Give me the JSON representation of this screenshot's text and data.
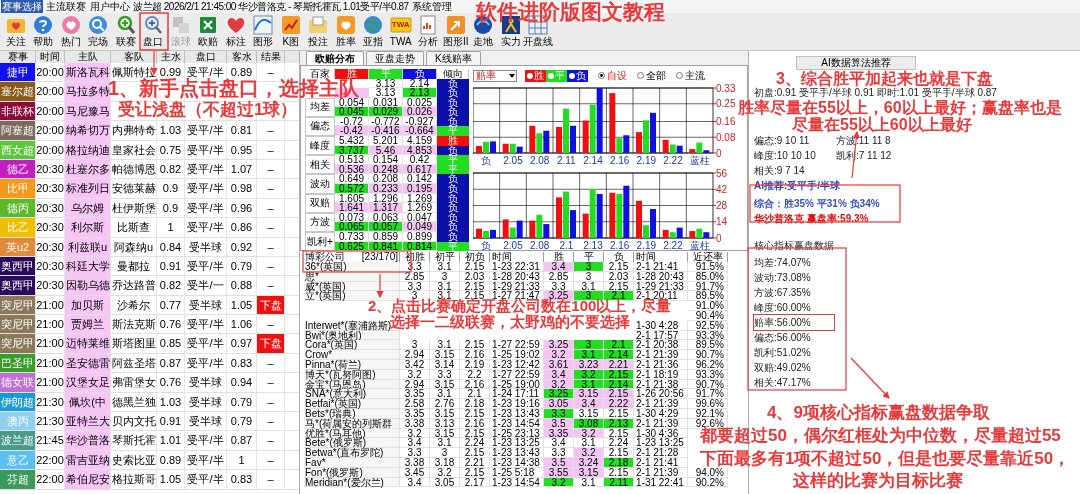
{
  "menu": {
    "items": [
      {
        "label": "赛事选择",
        "selected": true
      },
      {
        "label": "主流联赛",
        "selected": false
      },
      {
        "label": "用户中心",
        "selected": false
      }
    ],
    "match_info": "波兰超 2026/2/1 21:45:00 华沙普洛克 - 琴斯托霍瓦 1.01受平/半0.87",
    "trailing": [
      {
        "label": "系统管理",
        "selected": false
      }
    ]
  },
  "tutorial_title": "软件进阶版图文教程",
  "toolbar": [
    {
      "label": "关注",
      "disabled": false
    },
    {
      "label": "帮助",
      "disabled": false
    },
    {
      "label": "热门",
      "disabled": false
    },
    {
      "label": "完场",
      "disabled": false
    },
    {
      "label": "联赛",
      "disabled": false
    },
    {
      "label": "盘口",
      "disabled": false
    },
    {
      "label": "滚球",
      "disabled": true
    },
    {
      "label": "欧赔",
      "disabled": false
    },
    {
      "label": "标注",
      "disabled": false
    },
    {
      "label": "图形",
      "disabled": false
    },
    {
      "label": "K图",
      "disabled": false
    },
    {
      "label": "投注",
      "disabled": false
    },
    {
      "label": "胜率",
      "disabled": false
    },
    {
      "label": "亚指",
      "disabled": false
    },
    {
      "label": "TWA",
      "icon_text": "TWA",
      "disabled": false
    },
    {
      "label": "分析",
      "disabled": false
    },
    {
      "label": "图形II",
      "disabled": false
    },
    {
      "label": "走地",
      "disabled": false
    },
    {
      "label": "实力",
      "disabled": false
    },
    {
      "label": "开盘线",
      "disabled": false
    }
  ],
  "matches": {
    "columns": [
      "赛事",
      "时间",
      "主队",
      "客队",
      "主水",
      "盘口",
      "客水",
      "结果"
    ],
    "rows": [
      {
        "league": "捷甲",
        "color": "#1010f0",
        "time": "20:00",
        "home": "斯洛瓦科",
        "away": "佩斯特拉",
        "home_odds": "0.99",
        "handicap": "受平/半",
        "away_odds": "0.89",
        "result": "–",
        "flagged": false
      },
      {
        "league": "塞尔超",
        "color": "#8a5a1a",
        "time": "20:00",
        "home": "马拉多特"
      },
      {
        "league": "非联杯",
        "color": "#8a0a3a",
        "time": "20:00",
        "home": "马尼豫马"
      },
      {
        "league": "阿塞超",
        "color": "#7a6a5a",
        "time": "20:00",
        "home": "纳希切万",
        "away": "内弗特奇",
        "home_odds": "1.03",
        "handicap": "受平/半",
        "away_odds": "0.81",
        "result": "–",
        "flagged": false
      },
      {
        "league": "西女超",
        "color": "#5ac83a",
        "time": "20:00",
        "home": "格拉纳迪",
        "away": "皇家社会",
        "home_odds": "0.75",
        "handicap": "受平/半",
        "away_odds": "0.95",
        "result": "–",
        "flagged": false
      },
      {
        "league": "德乙",
        "color": "#c020c0",
        "time": "20:30",
        "home": "杜塞尔多",
        "away": "帕德博恩",
        "home_odds": "0.82",
        "handicap": "受平/半",
        "away_odds": "1.07",
        "result": "–",
        "flagged": false
      },
      {
        "league": "比甲",
        "color": "#f39a1a",
        "time": "20:30",
        "home": "标准列日",
        "away": "安德莱赫",
        "home_odds": "0.9",
        "handicap": "受平/半",
        "away_odds": "0.98",
        "result": "–",
        "flagged": false
      },
      {
        "league": "德丙",
        "color": "#5aba2a",
        "time": "20:30",
        "home": "乌尔姆",
        "away": "杜伊斯堡",
        "home_odds": "0.9",
        "handicap": "受平/半",
        "away_odds": "0.96",
        "result": "–",
        "flagged": false
      },
      {
        "league": "比乙",
        "color": "#f0c000",
        "time": "20:30",
        "home": "利尔斯",
        "away": "比斯查",
        "home_odds": "1",
        "handicap": "受平/半",
        "away_odds": "0.86",
        "result": "–",
        "flagged": false
      },
      {
        "league": "英u2",
        "color": "#e08a3a",
        "time": "20:30",
        "home": "利兹联u",
        "away": "阿森纳u",
        "home_odds": "0.84",
        "handicap": "受半球",
        "away_odds": "0.92",
        "result": "–",
        "flagged": false
      },
      {
        "league": "奥西甲",
        "color": "#2a0a5a",
        "time": "20:30",
        "home": "科廷大学",
        "away": "曼都拉",
        "home_odds": "0.91",
        "handicap": "受平/半",
        "away_odds": "0.79",
        "result": "–",
        "flagged": false
      },
      {
        "league": "奥西甲",
        "color": "#2a0a5a",
        "time": "20:30",
        "home": "因勒乌德",
        "away": "乔达路普",
        "home_odds": "0.82",
        "handicap": "受半/一",
        "away_odds": "0.88",
        "result": "–",
        "flagged": false
      },
      {
        "league": "突尼甲",
        "color": "#8a7a5a",
        "time": "21:00",
        "home": "加贝斯",
        "away": "沙希尔",
        "home_odds": "0.77",
        "handicap": "受半球",
        "away_odds": "1.05",
        "result": "下盘",
        "flagged": true
      },
      {
        "league": "突尼甲",
        "color": "#8a7a5a",
        "time": "21:00",
        "home": "贾姆兰",
        "away": "斯法克斯",
        "home_odds": "0.76",
        "handicap": "受平/半",
        "away_odds": "1.06",
        "result": "–",
        "flagged": false
      },
      {
        "league": "突尼甲",
        "color": "#8a7a5a",
        "time": "21:00",
        "home": "迈特莱维",
        "away": "斯塔图里",
        "home_odds": "0.85",
        "handicap": "受平/半",
        "away_odds": "0.97",
        "result": "下盘",
        "flagged": true
      },
      {
        "league": "巴圣甲",
        "color": "#3a9a2a",
        "time": "21:00",
        "home": "圣安德雷",
        "away": "阿兹圣塔",
        "home_odds": "0.87",
        "handicap": "受平/半",
        "away_odds": "0.83",
        "result": "–",
        "flagged": false
      },
      {
        "league": "德女联",
        "color": "#c070d0",
        "time": "21:00",
        "home": "汉堡女足",
        "away": "弗雷堡女",
        "home_odds": "0.76",
        "handicap": "受半球",
        "away_odds": "0.94",
        "result": "–",
        "flagged": false
      },
      {
        "league": "伊朗超",
        "color": "#1a9ad0",
        "time": "21:30",
        "home": "佩坎(中",
        "away": "德黑兰独",
        "home_odds": "1.03",
        "handicap": "受半球",
        "away_odds": "0.79",
        "result": "–",
        "flagged": false
      },
      {
        "league": "澳丙",
        "color": "#90d0f0",
        "time": "21:30",
        "home": "亚特兰大",
        "away": "贝内文托",
        "home_odds": "0.91",
        "handicap": "受半球",
        "away_odds": "0.79",
        "result": "–",
        "flagged": false
      },
      {
        "league": "波兰超",
        "color": "#4a9a8a",
        "time": "21:45",
        "home": "华沙普洛",
        "away": "琴斯托霍",
        "home_odds": "1.01",
        "handicap": "受平/半",
        "away_odds": "0.87",
        "result": "–",
        "flagged": false
      },
      {
        "league": "意乙",
        "color": "#5ac0f0",
        "time": "22:00",
        "home": "雷吉亚纳",
        "away": "史索比亚",
        "home_odds": "0.89",
        "handicap": "受平/半",
        "away_odds": "1",
        "result": "–",
        "flagged": false
      },
      {
        "league": "芬超",
        "color": "#3a9a5a",
        "time": "22:00",
        "home": "希伯尼安",
        "away": "格拉斯哥",
        "home_odds": "1.05",
        "handicap": "受平/半",
        "away_odds": "0.83",
        "result": "–",
        "flagged": false
      }
    ]
  },
  "tabs": [
    {
      "label": "欧赔分布",
      "selected": true
    },
    {
      "label": "亚盘走势",
      "selected": false
    },
    {
      "label": "K线赔率",
      "selected": false
    }
  ],
  "stats_table": {
    "columns": [
      {
        "label": "百家"
      },
      {
        "label": "胜",
        "color": "#f01010"
      },
      {
        "label": "平",
        "color": "#22dd22"
      },
      {
        "label": "负",
        "color": "#1010e0"
      },
      {
        "label": "倾向"
      }
    ],
    "groups": [
      {
        "rows": [
          {
            "cells": [
              {
                "hidden": true
              },
              {
                "text": "3.13"
              },
              {
                "text": "2.14"
              }
            ],
            "trend": {
              "label": "负",
              "color": "#0a10a8"
            }
          },
          {
            "cells": [
              {
                "hidden": true,
                "color": "#f4c4f4"
              },
              {
                "text": "3.13"
              },
              {
                "text": "2.13",
                "color": "#22dd22"
              }
            ],
            "trend": {
              "label": "负",
              "color": "#0a10a8"
            }
          }
        ]
      },
      {
        "label": "均差",
        "rows": [
          {
            "cells": [
              {
                "text": "0.054"
              },
              {
                "text": "0.031"
              },
              {
                "text": "0.025"
              }
            ],
            "trend": {
              "label": "负",
              "color": "#0a10a8"
            }
          },
          {
            "cells": [
              {
                "text": "0.045",
                "color": "#22dd22"
              },
              {
                "text": "0.029",
                "color": "#22dd22"
              },
              {
                "text": "0.026",
                "color": "#f4c4f4"
              }
            ],
            "trend": {
              "label": "负",
              "color": "#0a10a8"
            }
          }
        ]
      },
      {
        "label": "偏态",
        "rows": [
          {
            "cells": [
              {
                "text": "-0.72"
              },
              {
                "text": "-0.772"
              },
              {
                "text": "-0.927"
              }
            ],
            "trend": {
              "label": "负",
              "color": "#0a10a8"
            }
          },
          {
            "cells": [
              {
                "text": "-0.42",
                "color": "#f4c4f4"
              },
              {
                "text": "-0.416",
                "color": "#f4c4f4"
              },
              {
                "text": "-0.664",
                "color": "#f4c4f4"
              }
            ],
            "trend": {
              "label": "平",
              "color": "#22dd22"
            }
          }
        ]
      },
      {
        "label": "峰度",
        "rows": [
          {
            "cells": [
              {
                "text": "5.432"
              },
              {
                "text": "5.201"
              },
              {
                "text": "4.159"
              }
            ],
            "trend": {
              "label": "胜",
              "color": "#f01010"
            }
          },
          {
            "cells": [
              {
                "text": "3.737",
                "color": "#22dd22"
              },
              {
                "text": "5.46",
                "color": "#f4c4f4"
              },
              {
                "text": "4.853",
                "color": "#f4c4f4"
              }
            ],
            "trend": {
              "label": "负",
              "color": "#0a10a8"
            }
          }
        ]
      },
      {
        "label": "相关",
        "rows": [
          {
            "cells": [
              {
                "text": "0.513"
              },
              {
                "text": "0.154"
              },
              {
                "text": "0.42"
              }
            ],
            "trend": {
              "label": "平",
              "color": "#22dd22"
            }
          },
          {
            "cells": [
              {
                "text": "0.536",
                "color": "#f4c4f4"
              },
              {
                "text": "0.248",
                "color": "#f4c4f4"
              },
              {
                "text": "0.617",
                "color": "#f4c4f4"
              }
            ],
            "trend": {
              "label": "平",
              "color": "#22dd22"
            }
          }
        ]
      },
      {
        "label": "波动",
        "rows": [
          {
            "cells": [
              {
                "text": "0.649"
              },
              {
                "text": "0.208"
              },
              {
                "text": "0.142"
              }
            ],
            "trend": {
              "label": "负",
              "color": "#0a10a8"
            }
          },
          {
            "cells": [
              {
                "text": "0.572",
                "color": "#22dd22"
              },
              {
                "text": "0.233",
                "color": "#f4c4f4"
              },
              {
                "text": "0.195",
                "color": "#f4c4f4"
              }
            ],
            "trend": {
              "label": "负",
              "color": "#0a10a8"
            }
          }
        ]
      },
      {
        "label": "双赔",
        "rows": [
          {
            "cells": [
              {
                "text": "1.605"
              },
              {
                "text": "1.296"
              },
              {
                "text": "1.269"
              }
            ],
            "trend": {
              "label": "负",
              "color": "#0a10a8"
            }
          },
          {
            "cells": [
              {
                "text": "1.641",
                "color": "#f4c4f4"
              },
              {
                "text": "1.317",
                "color": "#f4c4f4"
              },
              {
                "text": "1.269"
              }
            ],
            "trend": {
              "label": "负",
              "color": "#0a10a8"
            }
          }
        ]
      },
      {
        "label": "方波",
        "rows": [
          {
            "cells": [
              {
                "text": "0.073"
              },
              {
                "text": "0.063"
              },
              {
                "text": "0.047"
              }
            ],
            "trend": {
              "label": "负",
              "color": "#0a10a8"
            }
          },
          {
            "cells": [
              {
                "text": "0.065",
                "color": "#22dd22"
              },
              {
                "text": "0.057",
                "color": "#22dd22"
              },
              {
                "text": "0.049",
                "color": "#f4c4f4"
              }
            ],
            "trend": {
              "label": "负",
              "color": "#0a10a8"
            }
          }
        ]
      },
      {
        "label": "凯利+",
        "rows": [
          {
            "cells": [
              {
                "text": "0.733"
              },
              {
                "text": "0.859"
              },
              {
                "text": "0.899"
              }
            ],
            "trend": {
              "label": "负",
              "color": "#0a10a8"
            }
          },
          {
            "cells": [
              {
                "text": "0.625",
                "color": "#22dd22"
              },
              {
                "text": "0.841",
                "color": "#22dd22"
              },
              {
                "text": "0.814",
                "color": "#22dd22"
              }
            ],
            "trend": {
              "label": "平",
              "color": "#22dd22"
            }
          }
        ]
      }
    ]
  },
  "chart_controls": {
    "dropdown": "赔率",
    "legend": [
      {
        "label": "胜",
        "color": "#f01010"
      },
      {
        "label": "平",
        "color": "#22dd22"
      },
      {
        "label": "负",
        "color": "#1010e0"
      }
    ],
    "radios": [
      {
        "label": "自设",
        "selected": true
      },
      {
        "label": "全部",
        "selected": false
      },
      {
        "label": "主流",
        "selected": false
      }
    ]
  },
  "charts": [
    {
      "chart_data": {
        "type": "bar",
        "grid": true,
        "categories": [
          "负",
          "2.05",
          "2.08",
          "2.11",
          "2.14",
          "2.16",
          "2.19",
          "2.22",
          "蓝柱"
        ],
        "ylim": [
          0,
          0.33
        ],
        "yticks": [
          0,
          0.08,
          0.16,
          0.25,
          0.33
        ],
        "series": [
          {
            "color": "#f01010",
            "values": [
              0.036,
              0.047,
              0.138,
              0.132,
              0.165,
              0.304,
              0.106,
              0.067,
              0.02
            ]
          },
          {
            "color": "#22dd22",
            "values": [
              0.057,
              0.047,
              0.1,
              0.225,
              0.245,
              0.075,
              0.166,
              0.043,
              0.053
            ]
          },
          {
            "color": "#1010e0",
            "values": [
              0.059,
              0.032,
              0.113,
              0.138,
              0.33,
              0.09,
              0.204,
              0.037,
              0.014
            ]
          }
        ]
      }
    },
    {
      "chart_data": {
        "type": "bar",
        "grid": true,
        "categories": [
          "负",
          "2.05",
          "2.08",
          "2.1",
          "2.13",
          "2.16",
          "2.19",
          "2.22",
          "蓝柱"
        ],
        "ylim": [
          0,
          56
        ],
        "yticks": [
          0,
          14,
          28,
          42,
          56
        ],
        "series": [
          {
            "color": "#f01010",
            "values": [
              8,
              16,
              15,
              35,
              21,
              39,
              32,
              7,
              6
            ]
          },
          {
            "color": "#22dd22",
            "values": [
              6,
              9,
              20,
              40,
              42,
              38,
              11,
              5,
              8
            ]
          },
          {
            "color": "#1010e0",
            "values": [
              7,
              15,
              12,
              24,
              38,
              45,
              25,
              9,
              5
            ]
          }
        ]
      }
    }
  ],
  "bookmakers": {
    "columns": [
      "博彩公司",
      "[23/170]",
      "初胜",
      "初平",
      "初负",
      "时间",
      "胜",
      "平",
      "负",
      "时间",
      "近还率"
    ],
    "rows": [
      {
        "company": "36*(英国)",
        "opening": [
          "3.3",
          "3.1",
          "2.15"
        ],
        "opening_time": "1-23 22:31",
        "live": [
          {
            "text": "3.4",
            "color": "#f4c4f4"
          },
          {
            "text": "3",
            "color": "#22dd22"
          },
          {
            "text": "2.15"
          }
        ],
        "live_time": "2-1 21:41",
        "return_rate": "91.5%"
      },
      {
        "company": "思*",
        "opening": [
          "2.85",
          "3",
          "2.03"
        ],
        "opening_time": "1-28 20:43",
        "live": [
          {
            "text": "2.85"
          },
          {
            "text": "3"
          },
          {
            "text": "2.03"
          }
        ],
        "live_time": "1-28 20:43",
        "return_rate": "85.0%"
      },
      {
        "company": "威*(英国)",
        "opening": [
          "3.3",
          "3.1",
          "2.15"
        ],
        "opening_time": "1-29 21:33",
        "live": [
          {
            "text": "3.3"
          },
          {
            "text": "3.1"
          },
          {
            "text": "2.15"
          }
        ],
        "live_time": "1-29 21:33",
        "return_rate": "91.7%"
      },
      {
        "company": "立*(英国)",
        "opening": [
          "3",
          "3.1",
          "2.15"
        ],
        "opening_time": "1-27 21:47",
        "live": [
          {
            "text": "3.25",
            "color": "#f4c4f4"
          },
          {
            "text": "3",
            "color": "#22dd22"
          },
          {
            "text": "2.1",
            "color": "#22dd22"
          }
        ],
        "live_time": "2-1 20:11",
        "return_rate": "89.5%"
      },
      {
        "return_rate": "91.0%"
      },
      {
        "return_rate": "90.4%"
      },
      {
        "company": "Interwet*(塞浦路斯)",
        "live_time": "1-30 4:28",
        "return_rate": "92.5%"
      },
      {
        "company": "Bwi*(奥地利)",
        "live_time": "2-1 17:57",
        "return_rate": "93.3%"
      },
      {
        "company": "Cora*(英国)",
        "opening": [
          "3",
          "3.1",
          "2.15"
        ],
        "opening_time": "1-27 22:59",
        "live": [
          {
            "text": "3.25",
            "color": "#f4c4f4"
          },
          {
            "text": "3",
            "color": "#22dd22"
          },
          {
            "text": "2.1",
            "color": "#22dd22"
          }
        ],
        "live_time": "2-1 20:38",
        "return_rate": "89.5%"
      },
      {
        "company": "Crow*",
        "opening": [
          "2.94",
          "3.15",
          "2.16"
        ],
        "opening_time": "1-25 19:02",
        "live": [
          {
            "text": "3.2",
            "color": "#f4c4f4"
          },
          {
            "text": "3.1",
            "color": "#22dd22"
          },
          {
            "text": "2.14",
            "color": "#22dd22"
          }
        ],
        "live_time": "2-1 21:39",
        "return_rate": "90.7%"
      },
      {
        "company": "Pinna*(荷兰)",
        "opening": [
          "3.42",
          "3.14",
          "2.19"
        ],
        "opening_time": "1-23 12:42",
        "live": [
          {
            "text": "3.61",
            "color": "#f4c4f4"
          },
          {
            "text": "3.23",
            "color": "#f4c4f4"
          },
          {
            "text": "2.21",
            "color": "#f4c4f4"
          }
        ],
        "live_time": "2-1 21:36",
        "return_rate": "96.2%"
      },
      {
        "company": "博天*(瓦努阿图)",
        "opening": [
          "3.2",
          "3.3",
          "2.2"
        ],
        "opening_time": "1-27 22:59",
        "live": [
          {
            "text": "3.4",
            "color": "#f4c4f4"
          },
          {
            "text": "3.2",
            "color": "#22dd22"
          },
          {
            "text": "2.15",
            "color": "#22dd22"
          }
        ],
        "live_time": "2-1 18:19",
        "return_rate": "93.3%"
      },
      {
        "company": "金宝*(马恩岛)",
        "opening": [
          "2.94",
          "3.15",
          "2.16"
        ],
        "opening_time": "1-25 19:00",
        "live": [
          {
            "text": "3.2",
            "color": "#f4c4f4"
          },
          {
            "text": "3.1",
            "color": "#22dd22"
          },
          {
            "text": "2.14",
            "color": "#22dd22"
          }
        ],
        "live_time": "2-1 21:38",
        "return_rate": "90.7%"
      },
      {
        "company": "SNA*(意大利)",
        "opening": [
          "3.35",
          "3.1",
          "2.1"
        ],
        "opening_time": "1-24 17:11",
        "live": [
          {
            "text": "3.25",
            "color": "#22dd22"
          },
          {
            "text": "3.15",
            "color": "#f4c4f4"
          },
          {
            "text": "2.15",
            "color": "#f4c4f4"
          }
        ],
        "live_time": "1-26 20:56",
        "return_rate": "91.7%"
      },
      {
        "company": "Betfai*(英国)",
        "opening": [
          "2.58",
          "2.76",
          "2.18"
        ],
        "opening_time": "1-23 19:16",
        "live": [
          {
            "text": "3.05",
            "color": "#f4c4f4"
          },
          {
            "text": "3.4",
            "color": "#f4c4f4"
          },
          {
            "text": "2.22",
            "color": "#f4c4f4"
          }
        ],
        "live_time": "2-1 21:39",
        "return_rate": "99.6%"
      },
      {
        "company": "Bets*(瑞典)",
        "opening": [
          "3.35",
          "3.15",
          "2.15"
        ],
        "opening_time": "1-23 13:43",
        "live": [
          {
            "text": "3.3",
            "color": "#22dd22"
          },
          {
            "text": "3.15"
          },
          {
            "text": "2.15"
          }
        ],
        "live_time": "1-30 4:29",
        "return_rate": "92.1%"
      },
      {
        "company": "马*(荷属安的列斯群",
        "opening": [
          "3.38",
          "3.13",
          "2.16"
        ],
        "opening_time": "1-23 14:54",
        "live": [
          {
            "text": "3.5",
            "color": "#f4c4f4"
          },
          {
            "text": "3.08",
            "color": "#22dd22"
          },
          {
            "text": "2.13",
            "color": "#22dd22"
          }
        ],
        "live_time": "2-1 21:39",
        "return_rate": "92.6%"
      },
      {
        "company": "优胜*(马耳他)",
        "opening": [
          "3.2",
          "3.15",
          "2.15"
        ],
        "opening_time": "1-25 23:13",
        "live": [
          {
            "text": "3.35",
            "color": "#f4c4f4"
          },
          {
            "text": "3.2",
            "color": "#f4c4f4"
          },
          {
            "text": "2.15"
          }
        ],
        "live_time": "1-30 4:36"
      },
      {
        "company": "Bete*(俄罗斯)",
        "opening": [
          "3.4",
          "3.1",
          "2.24"
        ],
        "opening_time": "1-23 13:25",
        "live": [
          {
            "text": "3.4"
          },
          {
            "text": "3.1"
          },
          {
            "text": "2.24"
          }
        ],
        "live_time": "1-23 13:25"
      },
      {
        "company": "Betwa*(直布罗陀)",
        "opening": [
          "3.3",
          "3",
          "2.15"
        ],
        "opening_time": "1-23 13:43",
        "live": [
          {
            "text": "3.3"
          },
          {
            "text": "3.2",
            "color": "#f4c4f4"
          },
          {
            "text": "2.15"
          }
        ],
        "live_time": "2-1 21:28"
      },
      {
        "company": "Fav*",
        "opening": [
          "3.38",
          "3.18",
          "2.21"
        ],
        "opening_time": "1-23 14:38",
        "live": [
          {
            "text": "3.5",
            "color": "#f4c4f4"
          },
          {
            "text": "3.24",
            "color": "#f4c4f4"
          },
          {
            "text": "2.18",
            "color": "#22dd22"
          }
        ],
        "live_time": "2-1 21:41"
      },
      {
        "company": "Fon*(俄罗斯)",
        "opening": [
          "3.45",
          "3.2",
          "2.15"
        ],
        "opening_time": "1-25 5:18",
        "live": [
          {
            "text": "3.55",
            "color": "#f4c4f4"
          },
          {
            "text": "3.15",
            "color": "#f4c4f4"
          },
          {
            "text": "2.15"
          }
        ],
        "live_time": "2-1 21:39",
        "return_rate": "94.0%"
      },
      {
        "company": "Meridian*(爱尔兰)",
        "opening": [
          "3.4",
          "3.05",
          "2.17"
        ],
        "opening_time": "1-23 14:54",
        "live": [
          {
            "text": "3.2",
            "color": "#22dd22"
          },
          {
            "text": "3.1"
          },
          {
            "text": "2.11",
            "color": "#22dd22"
          }
        ],
        "live_time": "1-31 22:41",
        "return_rate": "90.2%"
      }
    ]
  },
  "ai_panel": {
    "button": "AI数据算法推荐",
    "opening_line": "初盘:0.91 受平手/半球 0.91 即时:1.01 受平手/半球 0.87",
    "metric_rows": [
      [
        "偏态:9 10 11",
        "方波:11 11 8"
      ],
      [
        "峰度:10 10 10",
        "凯利:7 11 12"
      ],
      [
        "相关:9 7 14"
      ]
    ],
    "recommendation": "AI推荐:受平手/半球",
    "summary": "综合：胜35% 平31% 负34%",
    "win_rate": "华沙普洛克 赢盘率:59.3%",
    "core_title": "核心指标赢盘数据",
    "core_items": [
      {
        "text": "均差:74.07%",
        "boxed": false
      },
      {
        "text": "波动:73.08%",
        "boxed": false
      },
      {
        "text": "方波:67.35%",
        "boxed": false
      },
      {
        "text": "峰度:60.00%",
        "boxed": false
      },
      {
        "text": "赔率:56.00%",
        "boxed": true
      },
      {
        "text": "偏态:56.00%",
        "boxed": false
      },
      {
        "text": "凯利:51.02%",
        "boxed": false
      },
      {
        "text": "双赔:49.02%",
        "boxed": false
      },
      {
        "text": "相关:47.17%",
        "boxed": false
      }
    ]
  },
  "annotations": [
    {
      "lines": [
        "1、新手点击盘口，选择主队",
        "受让浅盘（不超过1球）"
      ]
    },
    {
      "lines": [
        "2、点击比赛确定开盘公司数在100以上，尽量",
        "选择一二级联赛，太野鸡的不要选择"
      ]
    },
    {
      "lines": [
        "3、综合胜平加起来也就是下盘",
        "胜率尽量在55以上，60以上最好；赢盘率也是",
        "尽量在55以上60以上最好"
      ]
    },
    {
      "lines": [
        "4、9项核心指标赢盘数据争取",
        "都要超过50，偶尔红框处为中位数，尽量超过55",
        "下面最多有1项不超过50，但是也要尽量靠近50，",
        "这样的比赛为目标比赛"
      ]
    }
  ]
}
